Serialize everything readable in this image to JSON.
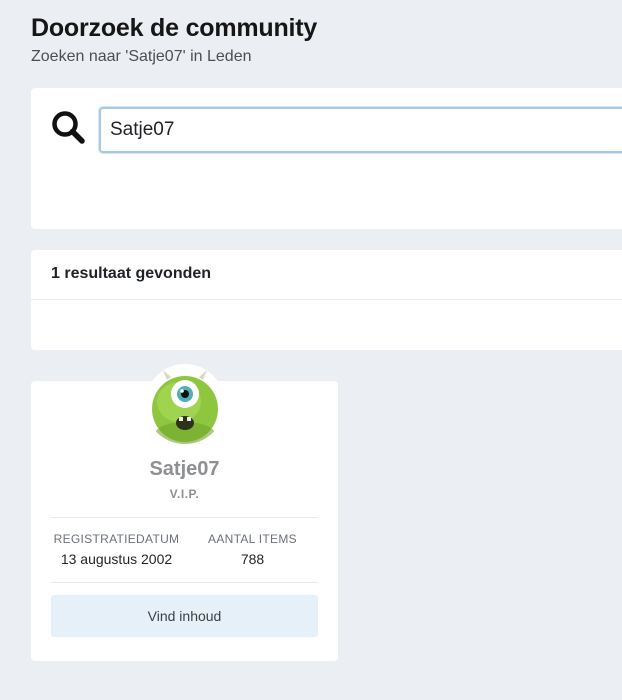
{
  "header": {
    "title": "Doorzoek de community",
    "subtitle": "Zoeken naar 'Satje07' in Leden"
  },
  "search": {
    "icon": "search-icon",
    "value": "Satje07"
  },
  "results": {
    "count_label": "1 resultaat gevonden"
  },
  "member": {
    "avatar_icon": "green-one-eyed-monster-avatar",
    "name": "Satje07",
    "rank": "V.I.P.",
    "stats": {
      "registration_label": "REGISTRATIEDATUM",
      "registration_value": "13 augustus 2002",
      "items_label": "AANTAL ITEMS",
      "items_value": "788"
    },
    "find_content_label": "Vind inhoud"
  },
  "colors": {
    "page_background": "#ebeef2",
    "input_focus_border": "#a9c8e6",
    "button_background": "#e6f0f9",
    "muted_name": "#8d8f92"
  }
}
